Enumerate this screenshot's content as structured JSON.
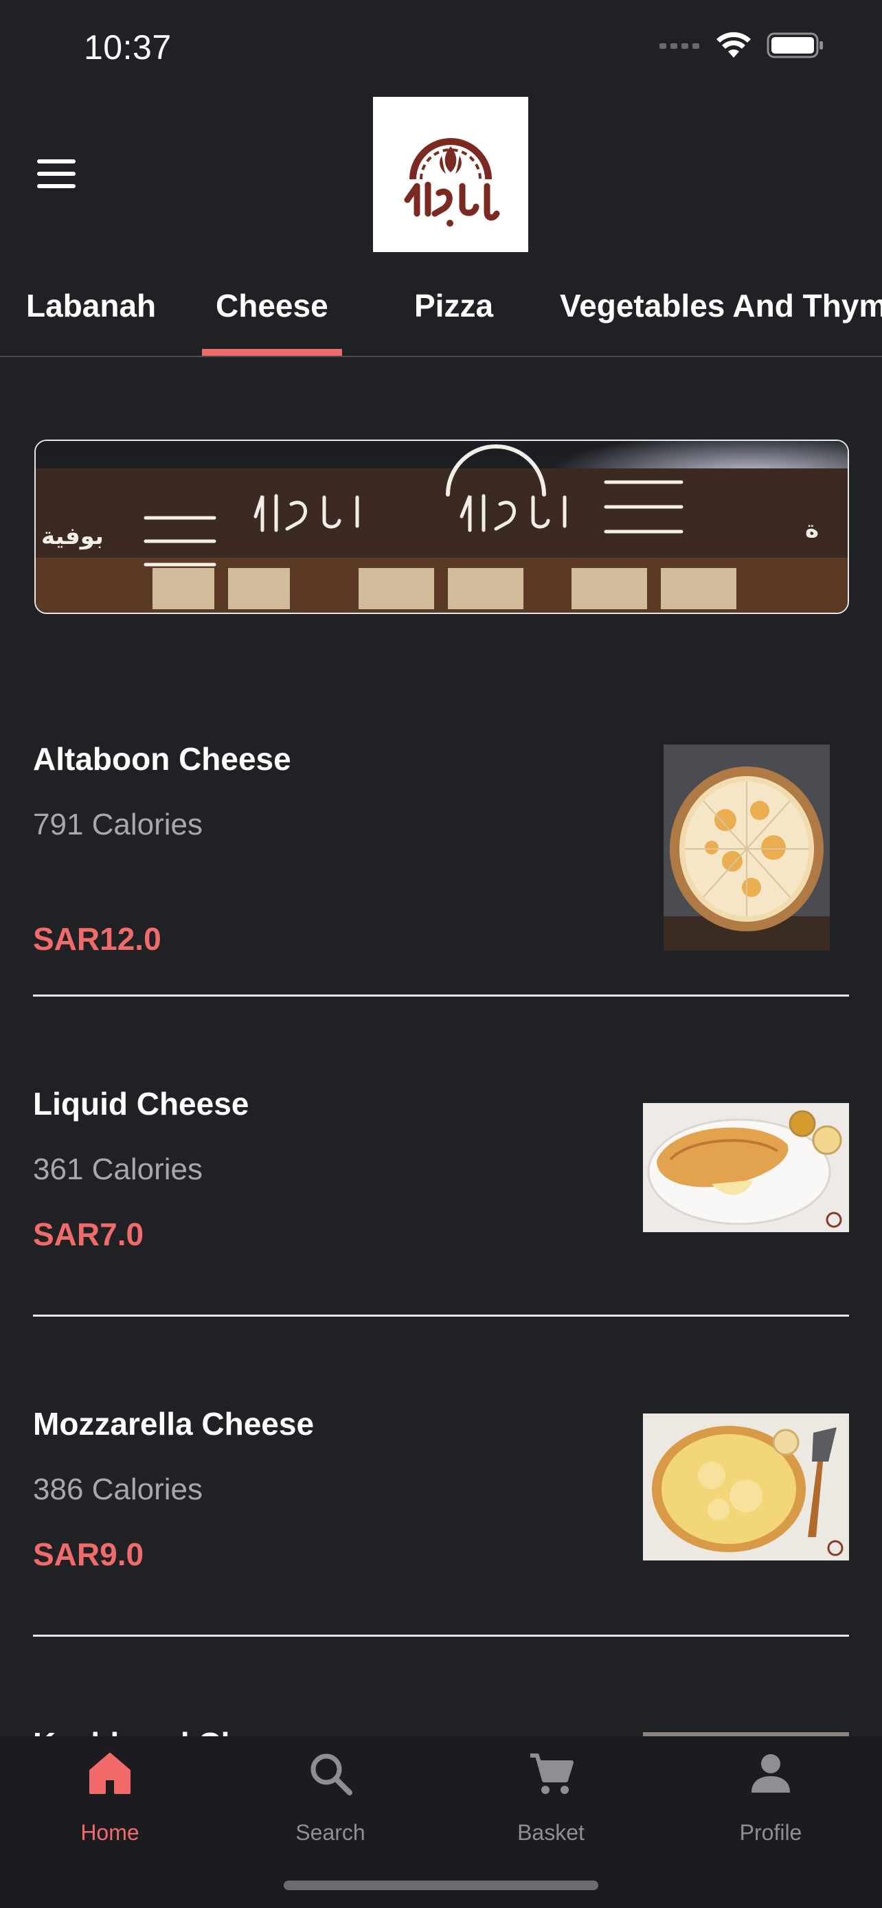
{
  "status_bar": {
    "time": "10:37"
  },
  "header": {
    "logo_alt": "Altaboon logo"
  },
  "tabs": [
    {
      "label": "Labanah"
    },
    {
      "label": "Cheese",
      "active": true
    },
    {
      "label": "Pizza"
    },
    {
      "label": "Vegetables And Thyme"
    }
  ],
  "items": [
    {
      "name": "Altaboon Cheese",
      "calories": "791 Calories",
      "price": "SAR12.0"
    },
    {
      "name": "Liquid Cheese",
      "calories": "361 Calories",
      "price": "SAR7.0"
    },
    {
      "name": "Mozzarella Cheese",
      "calories": "386 Calories",
      "price": "SAR9.0"
    },
    {
      "name": "Kashkaval Cheese"
    }
  ],
  "nav": [
    {
      "label": "Home",
      "icon": "home-icon",
      "active": true
    },
    {
      "label": "Search",
      "icon": "search-icon"
    },
    {
      "label": "Basket",
      "icon": "cart-icon"
    },
    {
      "label": "Profile",
      "icon": "profile-icon"
    }
  ],
  "colors": {
    "accent": "#f26b6b",
    "background": "#202125",
    "nav_background": "#1c1c20"
  }
}
